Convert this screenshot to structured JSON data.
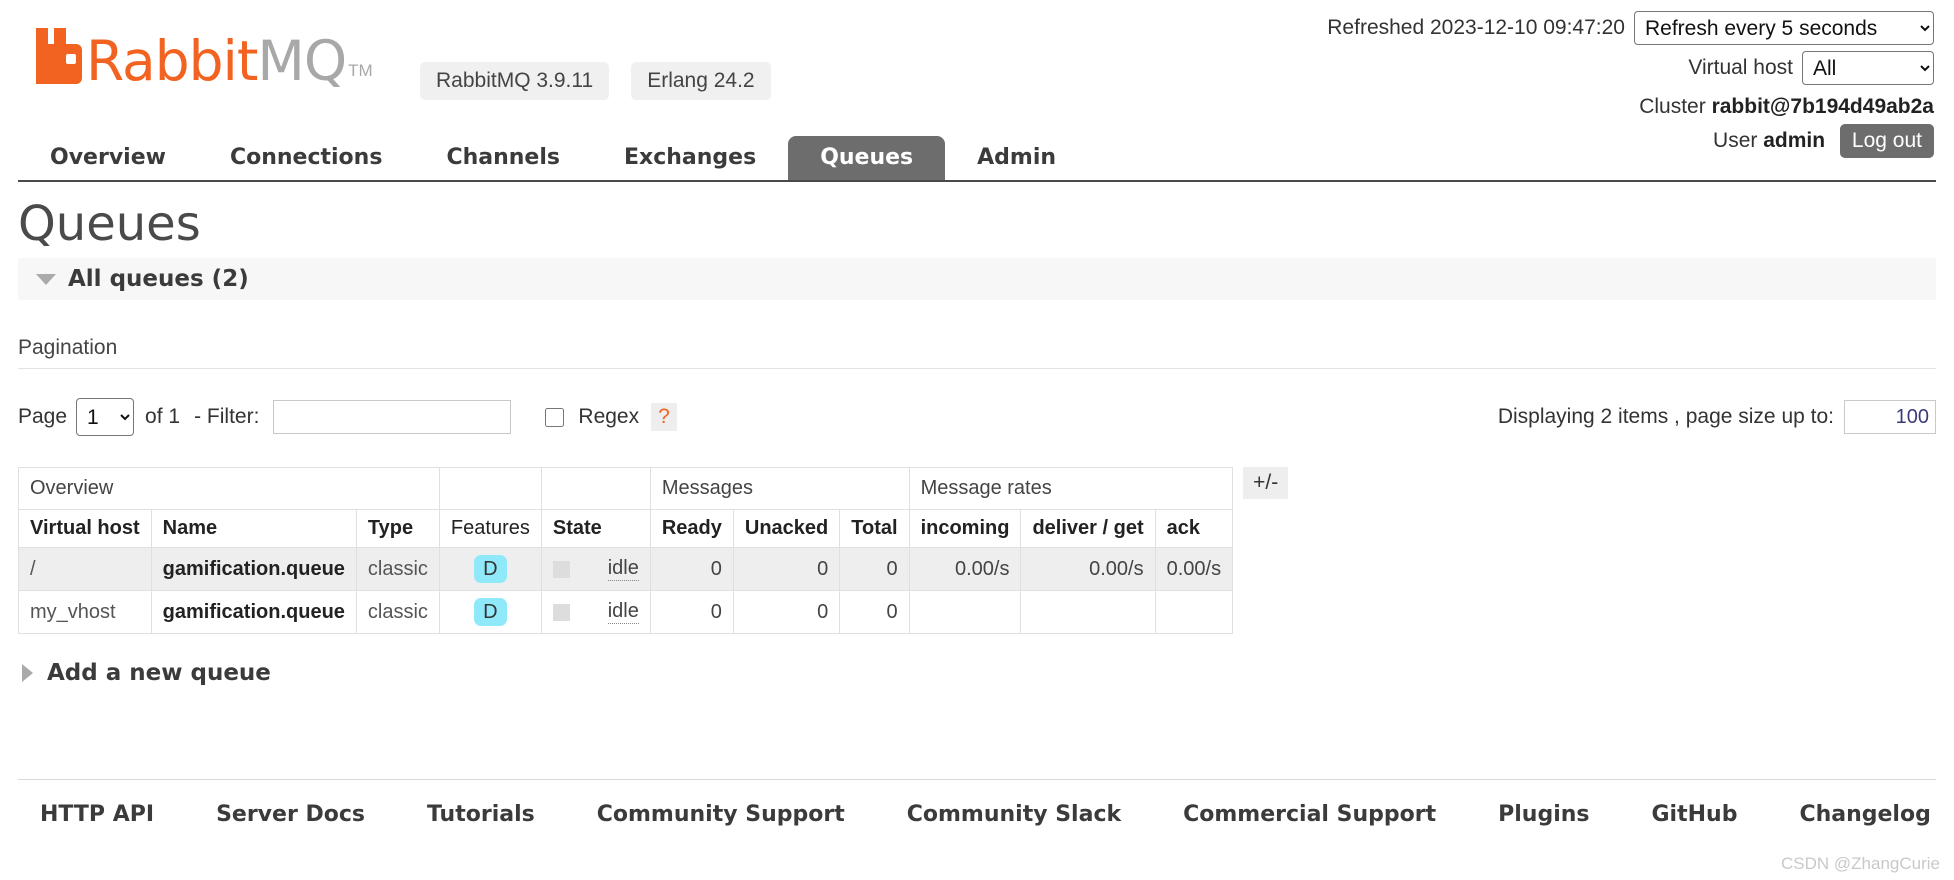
{
  "header": {
    "logo_rabbit": "Rabbit",
    "logo_mq": "MQ",
    "logo_tm": "TM",
    "badges": [
      {
        "label": "RabbitMQ 3.9.11"
      },
      {
        "label": "Erlang 24.2"
      }
    ],
    "refreshed_label": "Refreshed 2023-12-10 09:47:20",
    "refresh_select_value": "Refresh every 5 seconds",
    "refresh_options": [
      "Refresh every 5 seconds"
    ],
    "vhost_label": "Virtual host",
    "vhost_select_value": "All",
    "vhost_options": [
      "All"
    ],
    "cluster_label": "Cluster",
    "cluster_name": "rabbit@7b194d49ab2a",
    "user_label": "User",
    "user_name": "admin",
    "logout_label": "Log out"
  },
  "nav": {
    "items": [
      {
        "label": "Overview",
        "active": false
      },
      {
        "label": "Connections",
        "active": false
      },
      {
        "label": "Channels",
        "active": false
      },
      {
        "label": "Exchanges",
        "active": false
      },
      {
        "label": "Queues",
        "active": true
      },
      {
        "label": "Admin",
        "active": false
      }
    ]
  },
  "main": {
    "page_title": "Queues",
    "all_queues_label": "All queues (2)",
    "pagination_label": "Pagination",
    "page_label": "Page",
    "page_value": "1",
    "page_options": [
      "1"
    ],
    "of_label": "of 1",
    "filter_label": "- Filter:",
    "filter_value": "",
    "filter_placeholder": "",
    "regex_label": "Regex",
    "regex_help": "?",
    "regex_checked": false,
    "displaying_label": "Displaying 2 items , page size up to:",
    "pagesize_value": "100",
    "plus_minus_label": "+/-",
    "add_queue_label": "Add a new queue"
  },
  "table": {
    "group_headers": [
      {
        "label": "Overview",
        "span": 5
      },
      {
        "label": "Messages",
        "span": 3
      },
      {
        "label": "Message rates",
        "span": 3
      }
    ],
    "columns": [
      {
        "label": "Virtual host",
        "sortable": true,
        "align": "left"
      },
      {
        "label": "Name",
        "sortable": true,
        "align": "left"
      },
      {
        "label": "Type",
        "sortable": true,
        "align": "left"
      },
      {
        "label": "Features",
        "sortable": false,
        "align": "center"
      },
      {
        "label": "State",
        "sortable": true,
        "align": "left"
      },
      {
        "label": "Ready",
        "sortable": true,
        "align": "left"
      },
      {
        "label": "Unacked",
        "sortable": true,
        "align": "left"
      },
      {
        "label": "Total",
        "sortable": true,
        "align": "left"
      },
      {
        "label": "incoming",
        "sortable": true,
        "align": "left"
      },
      {
        "label": "deliver / get",
        "sortable": true,
        "align": "left"
      },
      {
        "label": "ack",
        "sortable": true,
        "align": "left"
      }
    ],
    "rows": [
      {
        "vhost": "/",
        "name": "gamification.queue",
        "type": "classic",
        "features": "D",
        "state": "idle",
        "ready": "0",
        "unacked": "0",
        "total": "0",
        "incoming": "0.00/s",
        "deliver_get": "0.00/s",
        "ack": "0.00/s"
      },
      {
        "vhost": "my_vhost",
        "name": "gamification.queue",
        "type": "classic",
        "features": "D",
        "state": "idle",
        "ready": "0",
        "unacked": "0",
        "total": "0",
        "incoming": "",
        "deliver_get": "",
        "ack": ""
      }
    ]
  },
  "footer": {
    "links": [
      {
        "label": "HTTP API"
      },
      {
        "label": "Server Docs"
      },
      {
        "label": "Tutorials"
      },
      {
        "label": "Community Support"
      },
      {
        "label": "Community Slack"
      },
      {
        "label": "Commercial Support"
      },
      {
        "label": "Plugins"
      },
      {
        "label": "GitHub"
      },
      {
        "label": "Changelog"
      }
    ],
    "watermark": "CSDN @ZhangCurie"
  },
  "colors": {
    "brand_orange": "#f26322",
    "logo_gray": "#a8a8a8",
    "tab_active_bg": "#6d6d6d",
    "feature_badge_bg": "#8fe9f9",
    "row_alt_bg": "#eeeeee"
  }
}
